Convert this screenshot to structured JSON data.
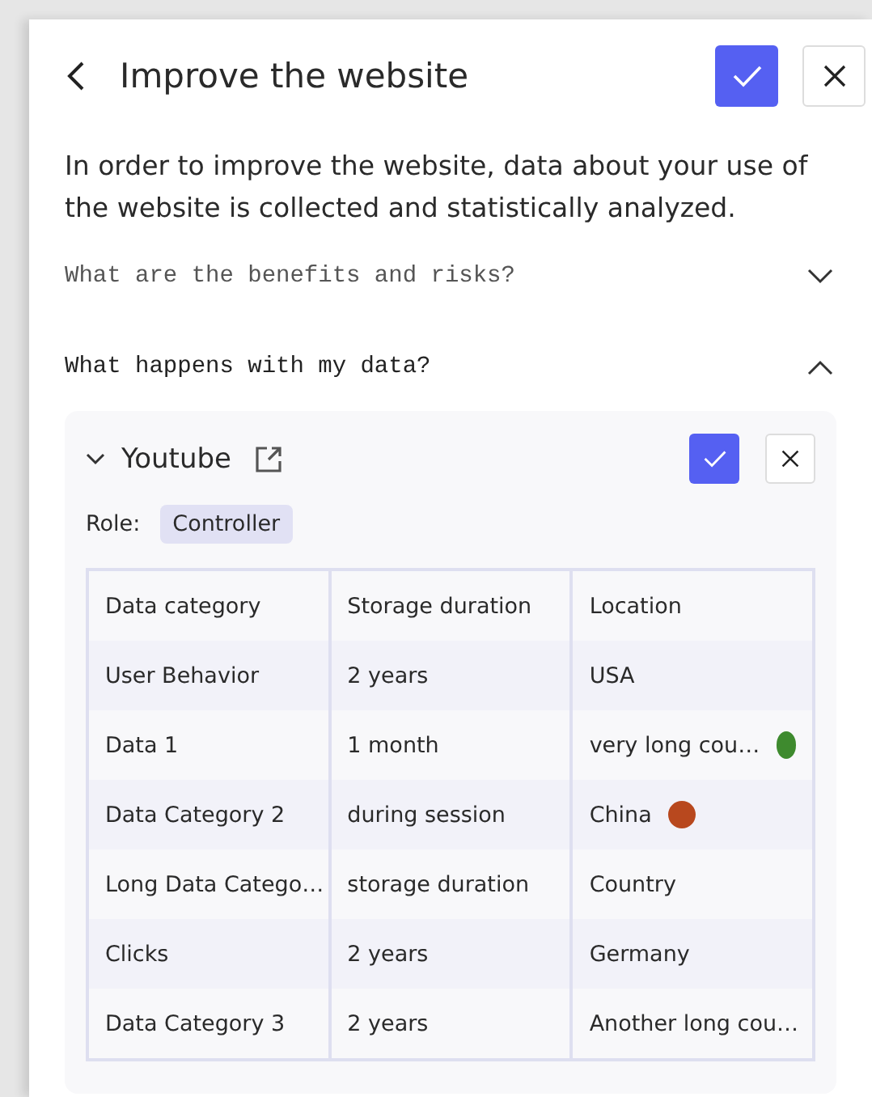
{
  "header": {
    "title": "Improve the website"
  },
  "description": "In order to improve the website, data about your use of the website is collected and statistically analyzed.",
  "sections": [
    {
      "label": "What are the benefits and risks?",
      "expanded": false
    },
    {
      "label": "What happens with my data?",
      "expanded": true
    }
  ],
  "service": {
    "name": "Youtube",
    "expanded": true,
    "role_label": "Role:",
    "role": "Controller",
    "table": {
      "columns": [
        "Data category",
        "Storage duration",
        "Location"
      ],
      "rows": [
        {
          "category": "User Behavior",
          "duration": "2 years",
          "location": "USA"
        },
        {
          "category": "Data 1",
          "duration": "1 month",
          "location": "very long cou…",
          "color": "#3e8a2e"
        },
        {
          "category": "Data Category 2",
          "duration": "during session",
          "location": "China",
          "color": "#b8481e"
        },
        {
          "category": "Long Data Catego…",
          "duration": "storage duration",
          "location": "Country"
        },
        {
          "category": "Clicks",
          "duration": "2 years",
          "location": "Germany"
        },
        {
          "category": "Data Category 3",
          "duration": "2 years",
          "location": "Another long cou…"
        }
      ]
    }
  }
}
